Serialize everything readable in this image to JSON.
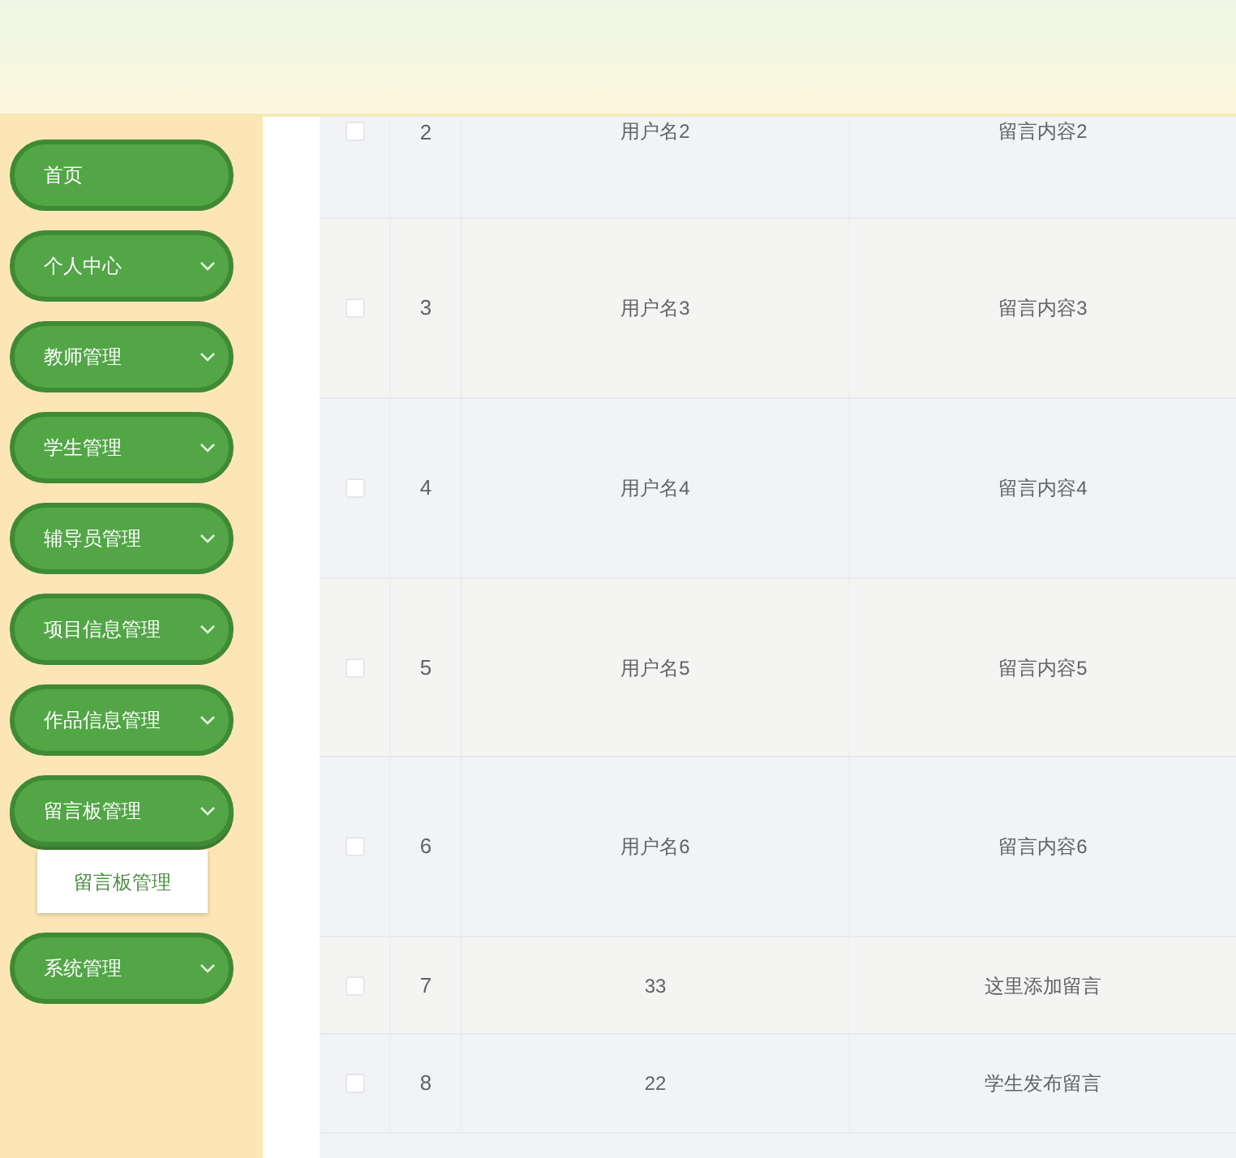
{
  "sidebar": {
    "items": [
      {
        "label": "首页",
        "has_children": false,
        "expanded": false
      },
      {
        "label": "个人中心",
        "has_children": true,
        "expanded": false
      },
      {
        "label": "教师管理",
        "has_children": true,
        "expanded": false
      },
      {
        "label": "学生管理",
        "has_children": true,
        "expanded": false
      },
      {
        "label": "辅导员管理",
        "has_children": true,
        "expanded": false
      },
      {
        "label": "项目信息管理",
        "has_children": true,
        "expanded": false
      },
      {
        "label": "作品信息管理",
        "has_children": true,
        "expanded": false
      },
      {
        "label": "留言板管理",
        "has_children": true,
        "expanded": true,
        "children": [
          {
            "label": "留言板管理"
          }
        ]
      },
      {
        "label": "系统管理",
        "has_children": true,
        "expanded": false
      }
    ]
  },
  "table": {
    "rows": [
      {
        "checked": false,
        "index": "2",
        "username": "用户名2",
        "content": "留言内容2"
      },
      {
        "checked": false,
        "index": "3",
        "username": "用户名3",
        "content": "留言内容3"
      },
      {
        "checked": false,
        "index": "4",
        "username": "用户名4",
        "content": "留言内容4"
      },
      {
        "checked": false,
        "index": "5",
        "username": "用户名5",
        "content": "留言内容5"
      },
      {
        "checked": false,
        "index": "6",
        "username": "用户名6",
        "content": "留言内容6"
      },
      {
        "checked": false,
        "index": "7",
        "username": "33",
        "content": "这里添加留言"
      },
      {
        "checked": false,
        "index": "8",
        "username": "22",
        "content": "学生发布留言"
      }
    ]
  }
}
